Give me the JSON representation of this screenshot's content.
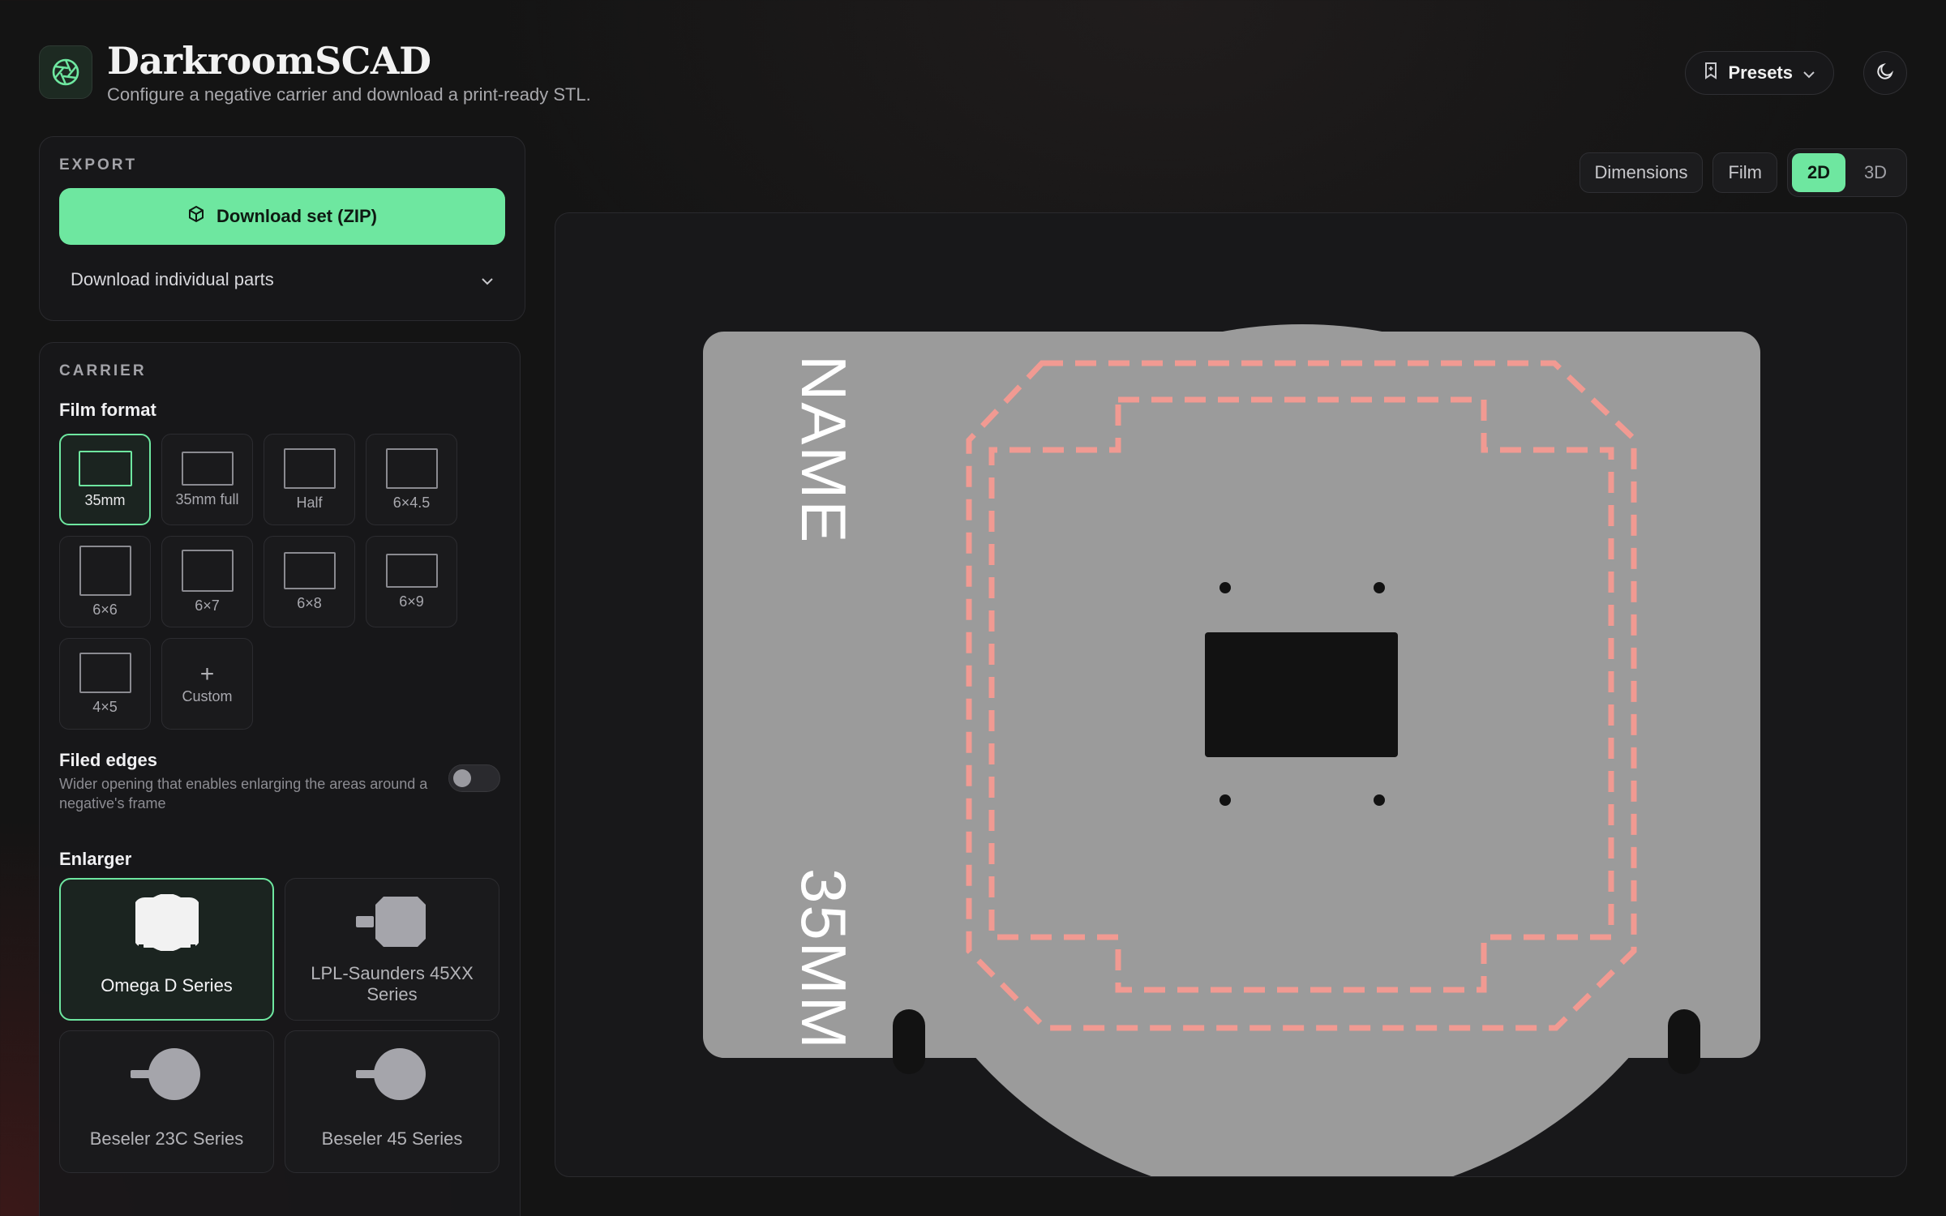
{
  "app": {
    "title": "DarkroomSCAD",
    "subtitle": "Configure a negative carrier and download a print-ready STL.",
    "icon": "aperture-icon"
  },
  "header": {
    "presets_label": "Presets",
    "theme_icon": "moon-icon"
  },
  "export": {
    "section_label": "EXPORT",
    "download_zip_label": "Download set (ZIP)",
    "download_individual_label": "Download individual parts"
  },
  "carrier": {
    "section_label": "CARRIER",
    "film_format_label": "Film format",
    "formats": [
      {
        "label": "35mm",
        "selected": true
      },
      {
        "label": "35mm full",
        "selected": false
      },
      {
        "label": "Half",
        "selected": false
      },
      {
        "label": "6×4.5",
        "selected": false
      },
      {
        "label": "6×6",
        "selected": false
      },
      {
        "label": "6×7",
        "selected": false
      },
      {
        "label": "6×8",
        "selected": false
      },
      {
        "label": "6×9",
        "selected": false
      },
      {
        "label": "4×5",
        "selected": false
      },
      {
        "label": "Custom",
        "selected": false
      }
    ],
    "filed_edges": {
      "label": "Filed edges",
      "description": "Wider opening that enables enlarging the areas around a negative's frame",
      "enabled": false
    },
    "enlarger_label": "Enlarger",
    "enlargers": [
      {
        "label": "Omega D Series",
        "selected": true
      },
      {
        "label": "LPL-Saunders 45XX Series",
        "selected": false
      },
      {
        "label": "Beseler 23C Series",
        "selected": false
      },
      {
        "label": "Beseler 45 Series",
        "selected": false
      }
    ]
  },
  "view": {
    "dimensions_label": "Dimensions",
    "film_label": "Film",
    "mode_2d": "2D",
    "mode_3d": "3D",
    "active_mode": "2D"
  },
  "preview": {
    "top_text": "NAME",
    "bottom_text": "35MM",
    "colors": {
      "plate": "#9b9b9b",
      "outline": "#f19a92",
      "aperture": "#121212",
      "accent": "#6ee7a0"
    }
  }
}
